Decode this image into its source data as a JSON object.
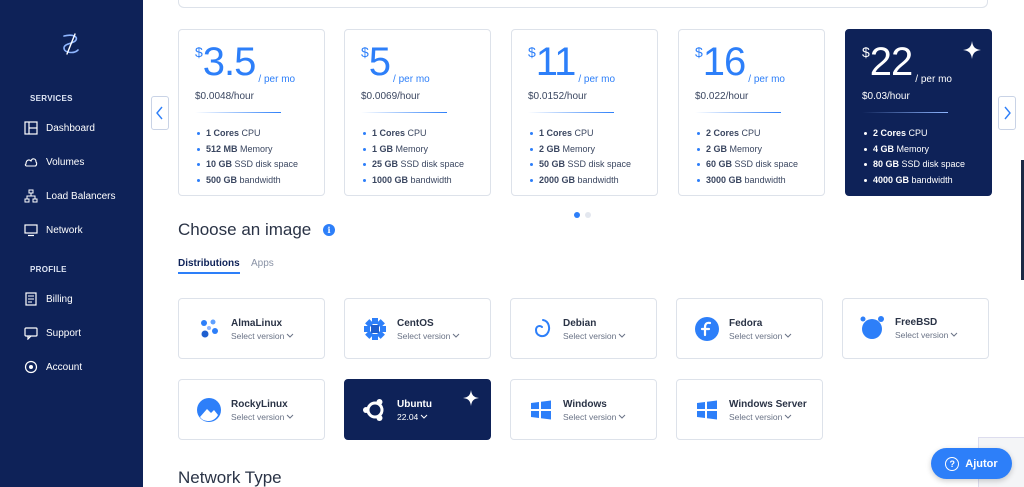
{
  "sidebar": {
    "services_label": "SERVICES",
    "profile_label": "PROFILE",
    "items": [
      {
        "label": "Dashboard",
        "icon": "dashboard-icon"
      },
      {
        "label": "Volumes",
        "icon": "volumes-icon"
      },
      {
        "label": "Load Balancers",
        "icon": "load-balancer-icon"
      },
      {
        "label": "Network",
        "icon": "network-icon"
      },
      {
        "label": "Billing",
        "icon": "billing-icon"
      },
      {
        "label": "Support",
        "icon": "support-icon"
      },
      {
        "label": "Account",
        "icon": "account-icon"
      }
    ]
  },
  "plans": [
    {
      "currency": "$",
      "amount": "3.5",
      "per": "/ per mo",
      "hourly": "$0.0048/hour",
      "specs": [
        [
          "1 Cores",
          "CPU"
        ],
        [
          "512 MB",
          "Memory"
        ],
        [
          "10 GB",
          "SSD disk space"
        ],
        [
          "500 GB",
          "bandwidth"
        ]
      ]
    },
    {
      "currency": "$",
      "amount": "5",
      "per": "/ per mo",
      "hourly": "$0.0069/hour",
      "specs": [
        [
          "1 Cores",
          "CPU"
        ],
        [
          "1 GB",
          "Memory"
        ],
        [
          "25 GB",
          "SSD disk space"
        ],
        [
          "1000 GB",
          "bandwidth"
        ]
      ]
    },
    {
      "currency": "$",
      "amount": "11",
      "per": "/ per mo",
      "hourly": "$0.0152/hour",
      "specs": [
        [
          "1 Cores",
          "CPU"
        ],
        [
          "2 GB",
          "Memory"
        ],
        [
          "50 GB",
          "SSD disk space"
        ],
        [
          "2000 GB",
          "bandwidth"
        ]
      ]
    },
    {
      "currency": "$",
      "amount": "16",
      "per": "/ per mo",
      "hourly": "$0.022/hour",
      "specs": [
        [
          "2 Cores",
          "CPU"
        ],
        [
          "2 GB",
          "Memory"
        ],
        [
          "60 GB",
          "SSD disk space"
        ],
        [
          "3000 GB",
          "bandwidth"
        ]
      ]
    },
    {
      "currency": "$",
      "amount": "22",
      "per": "/ per mo",
      "hourly": "$0.03/hour",
      "selected": true,
      "specs": [
        [
          "2 Cores",
          "CPU"
        ],
        [
          "4 GB",
          "Memory"
        ],
        [
          "80 GB",
          "SSD disk space"
        ],
        [
          "4000 GB",
          "bandwidth"
        ]
      ]
    }
  ],
  "carousel": {
    "pages": 2,
    "active_page": 1
  },
  "image_section": {
    "title": "Choose an image",
    "tabs": [
      "Distributions",
      "Apps"
    ],
    "active_tab": "Distributions"
  },
  "images": [
    {
      "name": "AlmaLinux",
      "version": "Select version",
      "icon": "almalinux-icon"
    },
    {
      "name": "CentOS",
      "version": "Select version",
      "icon": "centos-icon"
    },
    {
      "name": "Debian",
      "version": "Select version",
      "icon": "debian-icon"
    },
    {
      "name": "Fedora",
      "version": "Select version",
      "icon": "fedora-icon"
    },
    {
      "name": "FreeBSD",
      "version": "Select version",
      "icon": "freebsd-icon"
    },
    {
      "name": "RockyLinux",
      "version": "Select version",
      "icon": "rockylinux-icon"
    },
    {
      "name": "Ubuntu",
      "version": "22.04",
      "icon": "ubuntu-icon",
      "selected": true
    },
    {
      "name": "Windows",
      "version": "Select version",
      "icon": "windows-icon"
    },
    {
      "name": "Windows Server",
      "version": "Select version",
      "icon": "windows-icon"
    }
  ],
  "network_section": {
    "title": "Network Type"
  },
  "help_button": {
    "label": "Ajutor"
  },
  "colors": {
    "sidebar": "#0e2258",
    "accent": "#2d7ff9",
    "selected_card": "#0e2258"
  }
}
